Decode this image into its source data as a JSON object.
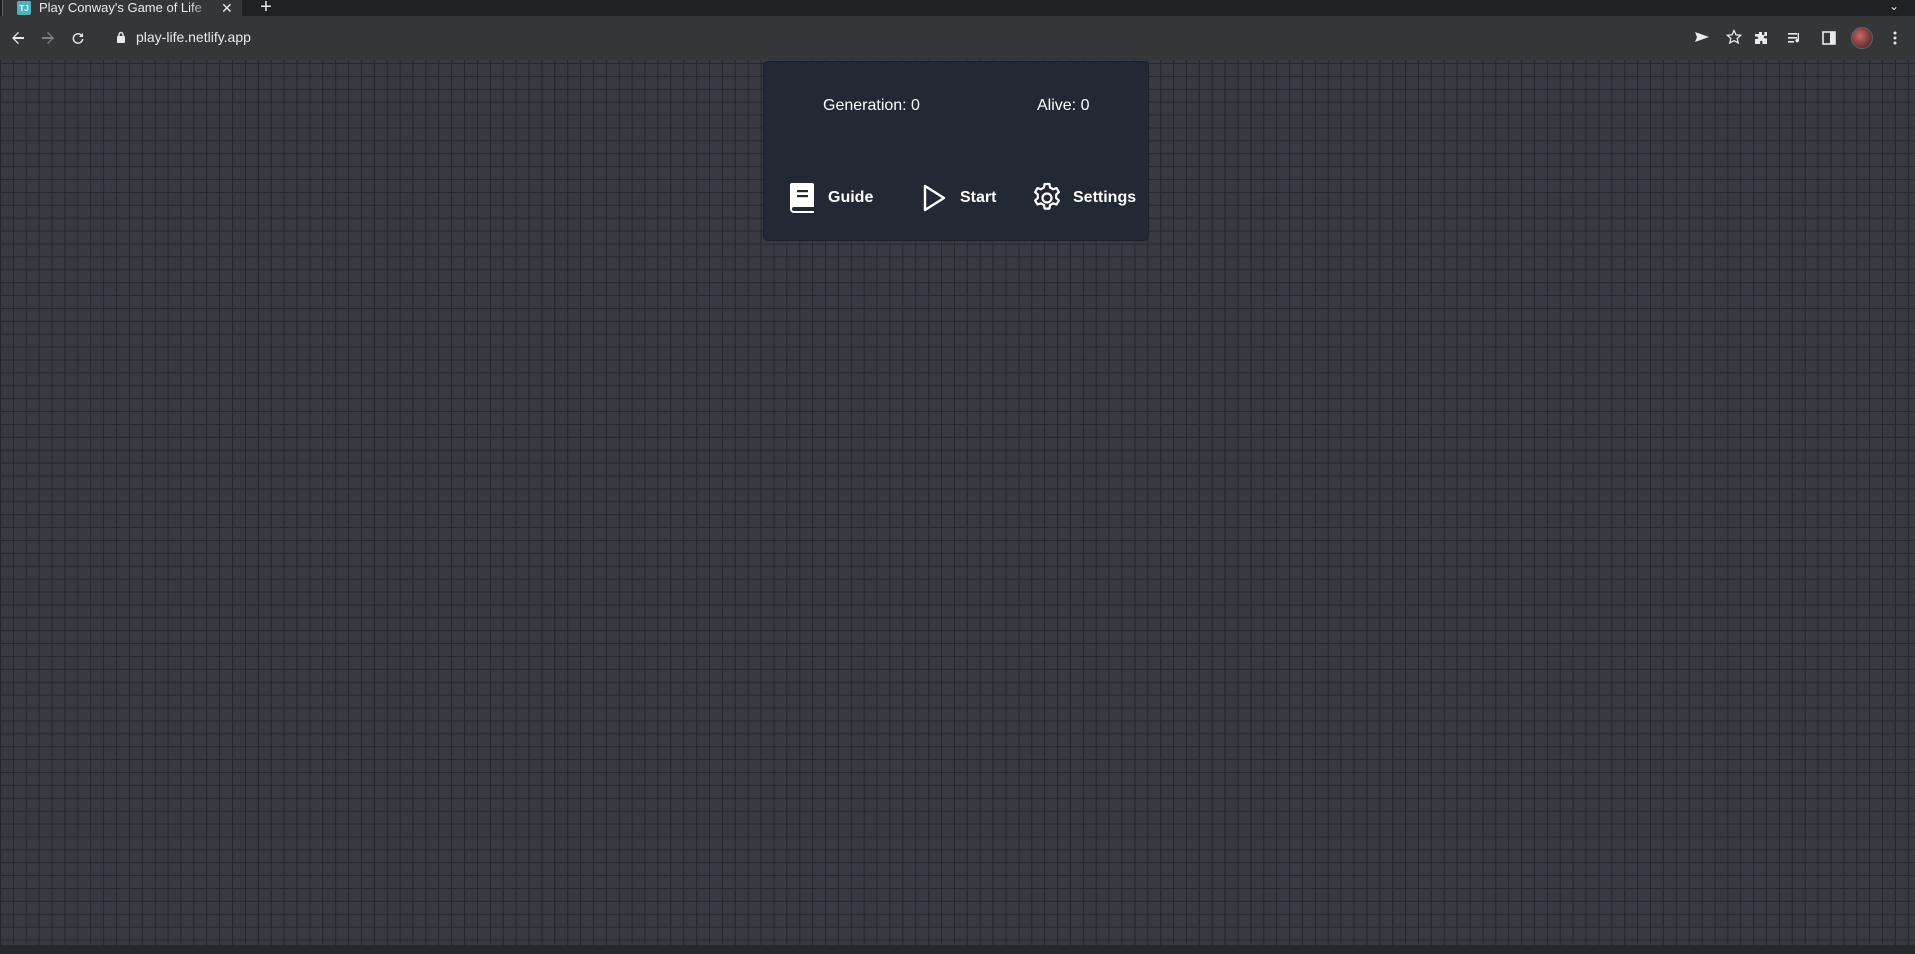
{
  "browser": {
    "tab": {
      "title": "Play Conway's Game of Life",
      "favicon_text": "TJ"
    },
    "url": "play-life.netlify.app"
  },
  "game": {
    "generation_label": "Generation: 0",
    "alive_label": "Alive: 0",
    "buttons": {
      "guide": "Guide",
      "start": "Start",
      "settings": "Settings"
    }
  },
  "colors": {
    "grid_cell": "#373a40",
    "grid_line": "#25272b",
    "panel_bg": "#222834"
  },
  "icons": [
    "book-icon",
    "play-icon",
    "gear-icon"
  ]
}
